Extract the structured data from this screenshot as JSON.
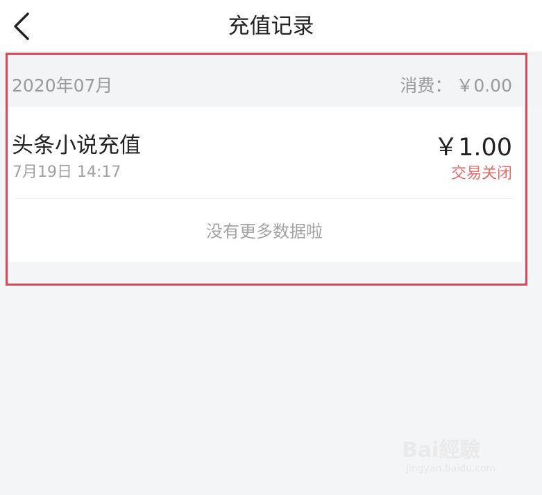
{
  "header": {
    "title": "充值记录",
    "back_icon": "chevron-left-icon"
  },
  "month_row": {
    "month": "2020年07月",
    "spend_label": "消费：",
    "spend_amount": "￥0.00"
  },
  "records": [
    {
      "title": "头条小说充值",
      "time": "7月19日 14:17",
      "amount": "￥1.00",
      "status": "交易关闭"
    }
  ],
  "no_more_text": "没有更多数据啦",
  "watermark": {
    "brand": "Bai經驗",
    "url": "jingyan.baidu.com"
  },
  "colors": {
    "background": "#f4f5f7",
    "status_red": "#e26d6d",
    "highlight_border": "#d7485a"
  }
}
